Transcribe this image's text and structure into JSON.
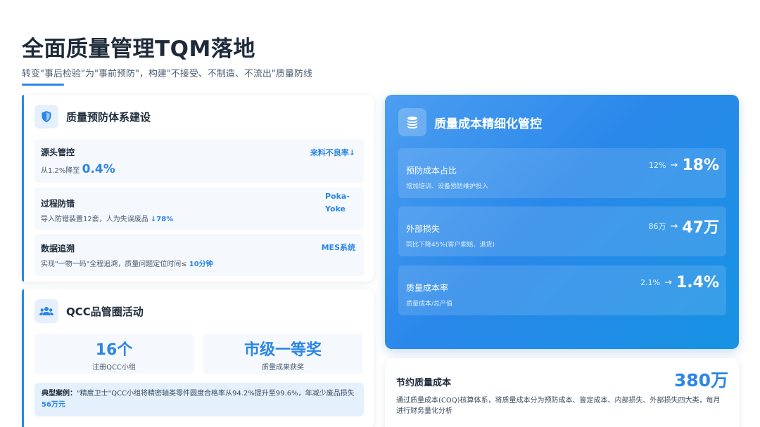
{
  "header": {
    "title": "全面质量管理TQM落地",
    "subtitle": "转变\"事后检验\"为\"事前预防\"，构建\"不接受、不制造、不流出\"质量防线"
  },
  "prevention": {
    "icon": "shield-icon",
    "title": "质量预防体系建设",
    "items": [
      {
        "name": "源头管控",
        "desc_prefix": "从1.2%降至",
        "desc_highlight": "0.4%",
        "tag": "来料不良率↓"
      },
      {
        "name": "过程防错",
        "desc_prefix": "导入防错装置12套，人为失误废品",
        "desc_highlight": "↓78%",
        "tag_line1": "Poka-",
        "tag_line2": "Yoke"
      },
      {
        "name": "数据追溯",
        "desc_prefix": "实现\"一物一码\"全程追溯，质量问题定位时间≤",
        "desc_highlight": "10分钟",
        "tag": "MES系统"
      }
    ]
  },
  "qcc": {
    "icon": "users-icon",
    "title": "QCC品管圈活动",
    "stats": [
      {
        "value": "16个",
        "label": "注册QCC小组"
      },
      {
        "value": "市级一等奖",
        "label": "质量成果获奖"
      }
    ],
    "case_label": "典型案例：",
    "case_text": "\"精度卫士\"QCC小组将精密轴类零件圆度合格率从94.2%提升至99.6%，年减少废品损失",
    "case_highlight": "56万元"
  },
  "cost_panel": {
    "icon": "coins-icon",
    "title": "质量成本精细化管控",
    "arrow": "→",
    "metrics": [
      {
        "name": "预防成本占比",
        "desc": "增加培训、设备预防维护投入",
        "old": "12%",
        "new": "18%"
      },
      {
        "name": "外部损失",
        "desc": "同比下降45%(客户索赔、退货)",
        "old": "86万",
        "new": "47万"
      },
      {
        "name": "质量成本率",
        "desc": "质量成本/总产值",
        "old": "2.1%",
        "new": "1.4%"
      }
    ]
  },
  "saving": {
    "label": "节约质量成本",
    "value": "380万",
    "desc": "通过质量成本(COQ)核算体系，将质量成本分为预防成本、鉴定成本、内部损失、外部损失四大类，每月进行财务量化分析"
  },
  "colors": {
    "accent": "#2b86e6",
    "panel_start": "#4c9ef0",
    "panel_end": "#1793e3"
  }
}
